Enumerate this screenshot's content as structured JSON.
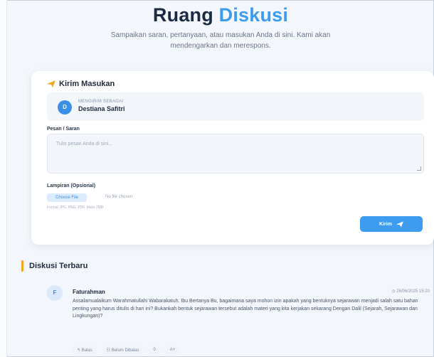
{
  "header": {
    "title_main": "Ruang ",
    "title_accent": "Diskusi",
    "subtitle_line1": "Sampaikan saran, pertanyaan, atau masukan Anda di sini. Kami akan",
    "subtitle_line2": "mendengarkan dan merespons."
  },
  "form": {
    "title": "Kirim Masukan",
    "user_caption": "MENGIRIM SEBAGAI",
    "user_initial": "D",
    "user_name": "Destiana Safitri",
    "message_label": "Pesan / Saran",
    "message_placeholder": "Tulis pesan Anda di sini...",
    "attachment_label": "Lampiran (Opsional)",
    "choose_file": "Choose File",
    "no_file": "No file chosen",
    "file_hint": "Format JPG, PNG, PDF. Maks 2MB",
    "submit_label": "Kirim"
  },
  "discussion": {
    "section_title": "Diskusi Terbaru",
    "posts": [
      {
        "initial": "F",
        "author": "Faturahman",
        "date": "26/06/2025 15:20",
        "body": "Assalamualaikum Warahmatullahi Wabarakatuh. Ibu Bertanya Bu, bagaimana saya mohon izin apakah yang bentuknya sejarawan menjadi salah satu bahan penting yang harus ditulis di hari ini? Bukankah bentuk sejarawan tersebut adalah materi yang kita kerjakan sekarang Dengan Dalil (Sejarah, Sejarawan dan Lingkungan)?",
        "reply": "Balas",
        "status": "Belum Dibalas",
        "likes": "0",
        "more": "A+"
      }
    ]
  },
  "colors": {
    "accent": "#3b9cf0",
    "section_bar": "#f5a422"
  }
}
